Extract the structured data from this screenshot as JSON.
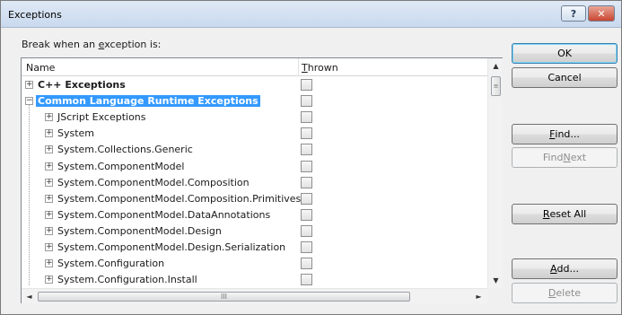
{
  "window": {
    "title": "Exceptions",
    "help_glyph": "?",
    "close_glyph": "✕"
  },
  "label": {
    "pre": "Break when an ",
    "underlined": "e",
    "post": "xception is:"
  },
  "columns": {
    "name": "Name",
    "thrown_underlined": "T",
    "thrown_rest": "hrown"
  },
  "rows": [
    {
      "label": "C++ Exceptions",
      "level": 0,
      "expander": "+",
      "bold": true,
      "selected": false,
      "thrown": false
    },
    {
      "label": "Common Language Runtime Exceptions",
      "level": 0,
      "expander": "−",
      "bold": true,
      "selected": true,
      "thrown": false
    },
    {
      "label": "JScript Exceptions",
      "level": 1,
      "expander": "+",
      "bold": false,
      "selected": false,
      "thrown": false
    },
    {
      "label": "System",
      "level": 1,
      "expander": "+",
      "bold": false,
      "selected": false,
      "thrown": false
    },
    {
      "label": "System.Collections.Generic",
      "level": 1,
      "expander": "+",
      "bold": false,
      "selected": false,
      "thrown": false
    },
    {
      "label": "System.ComponentModel",
      "level": 1,
      "expander": "+",
      "bold": false,
      "selected": false,
      "thrown": false
    },
    {
      "label": "System.ComponentModel.Composition",
      "level": 1,
      "expander": "+",
      "bold": false,
      "selected": false,
      "thrown": false
    },
    {
      "label": "System.ComponentModel.Composition.Primitives",
      "level": 1,
      "expander": "+",
      "bold": false,
      "selected": false,
      "thrown": false
    },
    {
      "label": "System.ComponentModel.DataAnnotations",
      "level": 1,
      "expander": "+",
      "bold": false,
      "selected": false,
      "thrown": false
    },
    {
      "label": "System.ComponentModel.Design",
      "level": 1,
      "expander": "+",
      "bold": false,
      "selected": false,
      "thrown": false
    },
    {
      "label": "System.ComponentModel.Design.Serialization",
      "level": 1,
      "expander": "+",
      "bold": false,
      "selected": false,
      "thrown": false
    },
    {
      "label": "System.Configuration",
      "level": 1,
      "expander": "+",
      "bold": false,
      "selected": false,
      "thrown": false
    },
    {
      "label": "System.Configuration.Install",
      "level": 1,
      "expander": "+",
      "bold": false,
      "selected": false,
      "thrown": false
    }
  ],
  "scrollbars": {
    "up": "▲",
    "down": "▼",
    "left": "◄",
    "right": "►",
    "v_grip": "≡",
    "h_grip": "III"
  },
  "buttons": {
    "ok": "OK",
    "cancel": "Cancel",
    "find_underlined": "F",
    "find_rest": "ind...",
    "findnext_pre": "Find ",
    "findnext_underlined": "N",
    "findnext_rest": "ext",
    "reset_underlined": "R",
    "reset_rest": "eset All",
    "add_underlined": "A",
    "add_rest": "dd...",
    "delete_underlined": "D",
    "delete_rest": "elete"
  }
}
